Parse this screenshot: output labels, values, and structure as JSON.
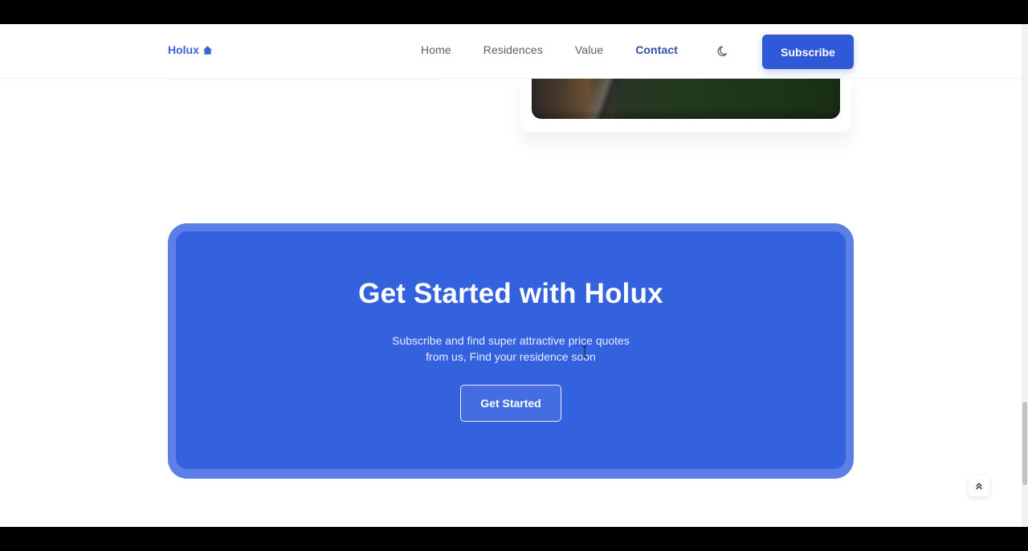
{
  "header": {
    "logo_text": "Holux",
    "logo_icon": "home-icon",
    "nav": [
      {
        "label": "Home",
        "active": false
      },
      {
        "label": "Residences",
        "active": false
      },
      {
        "label": "Value",
        "active": false
      },
      {
        "label": "Contact",
        "active": true
      }
    ],
    "theme_icon": "moon-icon",
    "subscribe_label": "Subscribe"
  },
  "get_started": {
    "title": "Get Started with Holux",
    "text_line1": "Subscribe and find super attractive price quotes",
    "text_line2": "from us, Find your residence soon",
    "button_label": "Get Started"
  },
  "scroll_top_icon": "double-chevron-up-icon",
  "colors": {
    "primary": "#2f59d6",
    "section_bg": "#3461de",
    "section_border": "#5b7fe6",
    "nav_active": "#2f4fa8"
  }
}
